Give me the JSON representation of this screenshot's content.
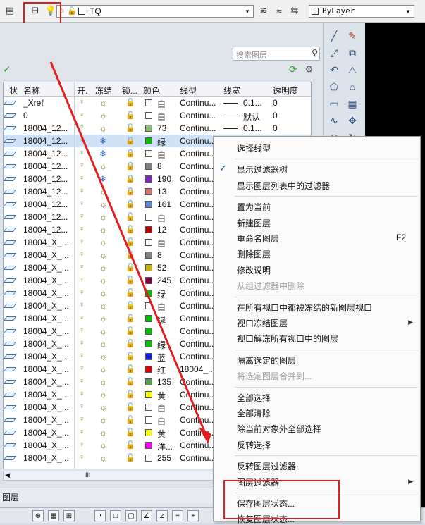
{
  "toolbar": {
    "layer_combo_text": "TQ",
    "bylayer_combo_text": "ByLayer"
  },
  "panel": {
    "search_placeholder": "搜索图层",
    "columns": [
      "状",
      "名称",
      "开.",
      "冻结",
      "锁...",
      "颜色",
      "线型",
      "线宽",
      "透明度"
    ],
    "rows": [
      {
        "name": "_Xref",
        "frozen": false,
        "locked": false,
        "color": "#ffffff",
        "color_label": "白",
        "linetype": "Continu...",
        "lineweight": "0.1...",
        "transparency": "0"
      },
      {
        "name": "0",
        "frozen": false,
        "locked": false,
        "color": "#ffffff",
        "color_label": "白",
        "linetype": "Continu...",
        "lineweight": "默认",
        "transparency": "0"
      },
      {
        "name": "18004_12...",
        "frozen": false,
        "locked": false,
        "color": "#8cc070",
        "color_label": "73",
        "linetype": "Continu...",
        "lineweight": "0.1...",
        "transparency": "0"
      },
      {
        "name": "18004_12...",
        "frozen": true,
        "locked": true,
        "color": "#00c000",
        "color_label": "绿",
        "linetype": "Continu...",
        "lineweight": "",
        "transparency": ""
      },
      {
        "name": "18004_12...",
        "frozen": true,
        "locked": true,
        "color": "#ffffff",
        "color_label": "白",
        "linetype": "Continu...",
        "lineweight": "",
        "transparency": ""
      },
      {
        "name": "18004_12...",
        "frozen": false,
        "locked": true,
        "color": "#808080",
        "color_label": "8",
        "linetype": "Continu...",
        "lineweight": "",
        "transparency": ""
      },
      {
        "name": "18004_12...",
        "frozen": true,
        "locked": true,
        "color": "#7f22c8",
        "color_label": "190",
        "linetype": "Continu...",
        "lineweight": "",
        "transparency": ""
      },
      {
        "name": "18004_12...",
        "frozen": false,
        "locked": true,
        "color": "#e07070",
        "color_label": "13",
        "linetype": "Continu...",
        "lineweight": "",
        "transparency": ""
      },
      {
        "name": "18004_12...",
        "frozen": false,
        "locked": true,
        "color": "#6088e0",
        "color_label": "161",
        "linetype": "Continu...",
        "lineweight": "",
        "transparency": ""
      },
      {
        "name": "18004_12...",
        "frozen": false,
        "locked": false,
        "color": "#ffffff",
        "color_label": "白",
        "linetype": "Continu...",
        "lineweight": "",
        "transparency": ""
      },
      {
        "name": "18004_12...",
        "frozen": false,
        "locked": false,
        "color": "#c00000",
        "color_label": "12",
        "linetype": "Continu...",
        "lineweight": "",
        "transparency": ""
      },
      {
        "name": "18004_X_...",
        "frozen": false,
        "locked": false,
        "color": "#ffffff",
        "color_label": "白",
        "linetype": "Continu...",
        "lineweight": "",
        "transparency": ""
      },
      {
        "name": "18004_X_...",
        "frozen": false,
        "locked": false,
        "color": "#808080",
        "color_label": "8",
        "linetype": "Continu...",
        "lineweight": "",
        "transparency": ""
      },
      {
        "name": "18004_X_...",
        "frozen": false,
        "locked": false,
        "color": "#c8b400",
        "color_label": "52",
        "linetype": "Continu...",
        "lineweight": "",
        "transparency": ""
      },
      {
        "name": "18004_X_...",
        "frozen": false,
        "locked": false,
        "color": "#800040",
        "color_label": "245",
        "linetype": "Continu...",
        "lineweight": "",
        "transparency": ""
      },
      {
        "name": "18004_X_...",
        "frozen": false,
        "locked": false,
        "color": "#00c000",
        "color_label": "绿",
        "linetype": "Continu...",
        "lineweight": "",
        "transparency": ""
      },
      {
        "name": "18004_X_...",
        "frozen": false,
        "locked": false,
        "color": "#ffffff",
        "color_label": "白",
        "linetype": "Continu...",
        "lineweight": "",
        "transparency": ""
      },
      {
        "name": "18004_X_...",
        "frozen": false,
        "locked": false,
        "color": "#00c000",
        "color_label": "绿",
        "linetype": "Continu...",
        "lineweight": "",
        "transparency": ""
      },
      {
        "name": "18004_X_...",
        "frozen": false,
        "locked": false,
        "color": "#00c000",
        "color_label": "",
        "linetype": "Continu...",
        "lineweight": "",
        "transparency": ""
      },
      {
        "name": "18004_X_...",
        "frozen": false,
        "locked": false,
        "color": "#00c000",
        "color_label": "绿",
        "linetype": "Continu...",
        "lineweight": "",
        "transparency": ""
      },
      {
        "name": "18004_X_...",
        "frozen": false,
        "locked": false,
        "color": "#1020e0",
        "color_label": "蓝",
        "linetype": "Continu...",
        "lineweight": "",
        "transparency": ""
      },
      {
        "name": "18004_X_...",
        "frozen": false,
        "locked": false,
        "color": "#e00000",
        "color_label": "红",
        "linetype": "18004_...",
        "lineweight": "",
        "transparency": ""
      },
      {
        "name": "18004_X_...",
        "frozen": false,
        "locked": false,
        "color": "#50a050",
        "color_label": "135",
        "linetype": "Continu...",
        "lineweight": "",
        "transparency": ""
      },
      {
        "name": "18004_X_...",
        "frozen": false,
        "locked": false,
        "color": "#ffff00",
        "color_label": "黄",
        "linetype": "Continu...",
        "lineweight": "",
        "transparency": ""
      },
      {
        "name": "18004_X_...",
        "frozen": false,
        "locked": false,
        "color": "#ffffff",
        "color_label": "白",
        "linetype": "Continu...",
        "lineweight": "",
        "transparency": ""
      },
      {
        "name": "18004_X_...",
        "frozen": false,
        "locked": false,
        "color": "#ffffff",
        "color_label": "白",
        "linetype": "Continu...",
        "lineweight": "",
        "transparency": ""
      },
      {
        "name": "18004_X_...",
        "frozen": false,
        "locked": false,
        "color": "#ffff00",
        "color_label": "黄",
        "linetype": "Continu...",
        "lineweight": "",
        "transparency": ""
      },
      {
        "name": "18004_X_...",
        "frozen": false,
        "locked": false,
        "color": "#ff00ff",
        "color_label": "洋...",
        "linetype": "Continu...",
        "lineweight": "",
        "transparency": ""
      },
      {
        "name": "18004_X_...",
        "frozen": false,
        "locked": false,
        "color": "#ffffff",
        "color_label": "255",
        "linetype": "Continu...",
        "lineweight": "",
        "transparency": ""
      }
    ],
    "hscroll_label": "III",
    "status_label": "图层"
  },
  "menu": {
    "items": [
      {
        "label": "选择线型",
        "enabled": true
      },
      {
        "separator": true
      },
      {
        "label": "显示过滤器树",
        "checked": true,
        "enabled": true
      },
      {
        "label": "显示图层列表中的过滤器",
        "enabled": true
      },
      {
        "separator": true
      },
      {
        "label": "置为当前",
        "enabled": true
      },
      {
        "label": "新建图层",
        "enabled": true
      },
      {
        "label": "重命名图层",
        "shortcut": "F2",
        "enabled": true
      },
      {
        "label": "删除图层",
        "enabled": true
      },
      {
        "label": "修改说明",
        "enabled": true
      },
      {
        "label": "从组过滤器中删除",
        "enabled": false
      },
      {
        "separator": true
      },
      {
        "label": "在所有视口中都被冻结的新图层视口",
        "enabled": true
      },
      {
        "label": "视口冻结图层",
        "submenu": true,
        "enabled": true
      },
      {
        "label": "视口解冻所有视口中的图层",
        "enabled": true
      },
      {
        "separator": true
      },
      {
        "label": "隔离选定的图层",
        "enabled": true
      },
      {
        "label": "将选定图层合并到...",
        "enabled": false
      },
      {
        "separator": true
      },
      {
        "label": "全部选择",
        "enabled": true
      },
      {
        "label": "全部清除",
        "enabled": true
      },
      {
        "label": "除当前对象外全部选择",
        "enabled": true
      },
      {
        "label": "反转选择",
        "enabled": true
      },
      {
        "separator": true
      },
      {
        "label": "反转图层过滤器",
        "enabled": true
      },
      {
        "label": "图层过滤器",
        "submenu": true,
        "enabled": true
      },
      {
        "separator": true
      },
      {
        "label": "保存图层状态...",
        "enabled": true
      },
      {
        "label": "恢复图层状态...",
        "enabled": true
      }
    ]
  },
  "colors": {
    "highlight_red": "#e02020",
    "selection_blue": "#cfe2f7"
  }
}
